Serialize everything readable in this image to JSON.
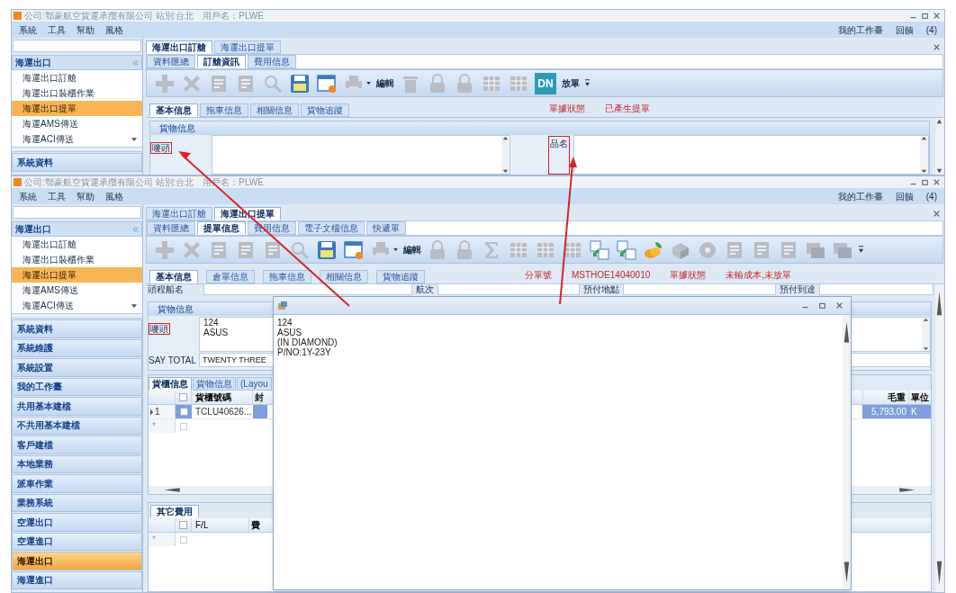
{
  "windows": [
    {
      "kind": "order",
      "title": "公司:鄂豪航空貨運承攬有限公司 站別:台北　用戶名：PLWE",
      "menu": [
        "系統",
        "工具",
        "幫助",
        "風格"
      ],
      "menu_right": [
        "我的工作臺",
        "回饋",
        "(4)"
      ],
      "sidebar": {
        "header": "海運出口",
        "items": [
          {
            "label": "海運出口訂艙",
            "selected": false
          },
          {
            "label": "海運出口裝櫃作業",
            "selected": false
          },
          {
            "label": "海運出口提單",
            "selected": true
          },
          {
            "label": "海運AMS傳送",
            "selected": false
          },
          {
            "label": "海運ACI傳送",
            "selected": false
          }
        ],
        "groups": [
          {
            "label": "系統資料",
            "selected": false
          }
        ]
      },
      "doc_tabs": [
        {
          "label": "海運出口訂艙",
          "selected": true
        },
        {
          "label": "海運出口提單",
          "selected": false
        }
      ],
      "sub_tabs": [
        {
          "label": "資料匯總",
          "selected": false
        },
        {
          "label": "訂艙資訊",
          "selected": true
        },
        {
          "label": "費用信息",
          "selected": false
        }
      ],
      "toolbar": [
        {
          "kind": "plus",
          "disabled": true
        },
        {
          "kind": "cross",
          "disabled": true
        },
        {
          "kind": "note",
          "disabled": true
        },
        {
          "kind": "note",
          "disabled": true
        },
        {
          "kind": "search",
          "disabled": true
        },
        {
          "kind": "save",
          "disabled": false
        },
        {
          "kind": "window",
          "disabled": false
        },
        {
          "kind": "printer",
          "disabled": true
        },
        {
          "kind": "caret"
        },
        {
          "kind": "label",
          "text": "編輯"
        },
        {
          "kind": "trash",
          "disabled": true
        },
        {
          "kind": "lock",
          "disabled": true
        },
        {
          "kind": "lock",
          "disabled": true
        },
        {
          "kind": "sheet",
          "disabled": true
        },
        {
          "kind": "sheet",
          "disabled": true
        },
        {
          "kind": "dn",
          "text": "DN"
        },
        {
          "kind": "label",
          "text": "放單"
        },
        {
          "kind": "overflow"
        }
      ],
      "inner_tabs": [
        {
          "label": "基本信息",
          "selected": true
        },
        {
          "label": "拖車信息",
          "selected": false
        },
        {
          "label": "相關信息",
          "selected": false
        },
        {
          "label": "貨物追蹤",
          "selected": false
        }
      ],
      "status": [
        "單據狀態",
        "已產生提單"
      ],
      "cargo": {
        "title": "貨物信息",
        "marks_label": {
          "text": "嘜頭",
          "highlighted": true
        },
        "goods_label": {
          "text": "品名",
          "highlighted": true
        }
      }
    },
    {
      "kind": "bill",
      "title": "公司:鄂豪航空貨運承攬有限公司 站別:台北　用戶名：PLWE",
      "menu": [
        "系統",
        "工具",
        "幫助",
        "風格"
      ],
      "menu_right": [
        "我的工作臺",
        "回饋",
        "(4)"
      ],
      "sidebar": {
        "header": "海運出口",
        "items": [
          {
            "label": "海運出口訂艙",
            "selected": false
          },
          {
            "label": "海運出口裝櫃作業",
            "selected": false
          },
          {
            "label": "海運出口提單",
            "selected": true
          },
          {
            "label": "海運AMS傳送",
            "selected": false
          },
          {
            "label": "海運ACI傳送",
            "selected": false
          }
        ],
        "groups": [
          {
            "label": "系統資料",
            "selected": false
          },
          {
            "label": "系統維護",
            "selected": false
          },
          {
            "label": "系統設置",
            "selected": false
          },
          {
            "label": "我的工作臺",
            "selected": false
          },
          {
            "label": "共用基本建檔",
            "selected": false
          },
          {
            "label": "不共用基本建檔",
            "selected": false
          },
          {
            "label": "客戶建檔",
            "selected": false
          },
          {
            "label": "本地業務",
            "selected": false
          },
          {
            "label": "派車作業",
            "selected": false
          },
          {
            "label": "業務系統",
            "selected": false
          },
          {
            "label": "空運出口",
            "selected": false
          },
          {
            "label": "空運進口",
            "selected": false
          },
          {
            "label": "海運出口",
            "selected": true
          },
          {
            "label": "海運進口",
            "selected": false
          }
        ]
      },
      "doc_tabs": [
        {
          "label": "海運出口訂艙",
          "selected": false
        },
        {
          "label": "海運出口提單",
          "selected": true
        }
      ],
      "sub_tabs": [
        {
          "label": "資料匯總",
          "selected": false
        },
        {
          "label": "提單信息",
          "selected": true
        },
        {
          "label": "費用信息",
          "selected": false
        },
        {
          "label": "電子文檔信息",
          "selected": false
        },
        {
          "label": "快遞單",
          "selected": false
        }
      ],
      "toolbar": [
        {
          "kind": "plus",
          "disabled": true
        },
        {
          "kind": "cross",
          "disabled": true
        },
        {
          "kind": "note",
          "disabled": true
        },
        {
          "kind": "note",
          "disabled": true
        },
        {
          "kind": "note",
          "disabled": true
        },
        {
          "kind": "search",
          "disabled": true
        },
        {
          "kind": "save",
          "disabled": false
        },
        {
          "kind": "window",
          "disabled": false
        },
        {
          "kind": "printer",
          "disabled": true
        },
        {
          "kind": "caret"
        },
        {
          "kind": "label",
          "text": "編輯"
        },
        {
          "kind": "lock",
          "disabled": true
        },
        {
          "kind": "lock",
          "disabled": true
        },
        {
          "kind": "sigma",
          "disabled": true
        },
        {
          "kind": "sheet",
          "disabled": true
        },
        {
          "kind": "sheet",
          "disabled": true
        },
        {
          "kind": "sheet",
          "disabled": true
        },
        {
          "kind": "swap",
          "disabled": false
        },
        {
          "kind": "swap",
          "disabled": false
        },
        {
          "kind": "coins",
          "disabled": false
        },
        {
          "kind": "box",
          "disabled": true
        },
        {
          "kind": "disc",
          "disabled": true
        },
        {
          "kind": "note",
          "disabled": true
        },
        {
          "kind": "note",
          "disabled": true
        },
        {
          "kind": "note",
          "disabled": true
        },
        {
          "kind": "stack",
          "disabled": true
        },
        {
          "kind": "stack",
          "disabled": true
        },
        {
          "kind": "overflow"
        }
      ],
      "inner_tabs": [
        {
          "label": "基本信息",
          "selected": true
        },
        {
          "label": "倉單信息",
          "selected": false
        },
        {
          "label": "拖車信息",
          "selected": false
        },
        {
          "label": "相關信息",
          "selected": false
        },
        {
          "label": "貨物追蹤",
          "selected": false
        }
      ],
      "status": [
        "分單號",
        "MSTHOE14040010",
        "單據狀態",
        "未輸成本,未放單"
      ],
      "ship_row": {
        "vessel_label": "頭程船名",
        "voyage_label": "航次",
        "prepaid_place_label": "預付地點",
        "prepaid_arrival_label": "預付到達"
      },
      "cargo": {
        "title": "貨物信息",
        "marks_label": {
          "text": "嘜頭",
          "highlighted": true
        },
        "marks_lines": [
          "124",
          "ASUS"
        ],
        "say_total_label": "SAY TOTAL",
        "say_total_value": "TWENTY THREE"
      },
      "container_grid": {
        "tabs": [
          {
            "label": "貨櫃信息",
            "selected": true
          },
          {
            "label": "貨物信息",
            "selected": false
          },
          {
            "label": "(Layou",
            "selected": false
          }
        ],
        "columns": [
          "貨櫃號碼",
          "封",
          "毛重",
          "單位"
        ],
        "header_checked": false,
        "new_row_checked": false,
        "rows": [
          {
            "header": "1",
            "current": true,
            "checked": false,
            "cells": [
              "TCLU40626...",
              "",
              "5,793.00",
              "K"
            ]
          }
        ],
        "new_row": "*"
      },
      "fees_grid": {
        "tab": "其它費用",
        "columns": [
          "F/L",
          "費"
        ],
        "header_checked": false,
        "new_row_checked": false,
        "new_row": "*"
      }
    }
  ],
  "popup": {
    "lines": [
      "124",
      "ASUS",
      "(IN DIAMOND)",
      "P/NO:1Y-23Y"
    ]
  }
}
